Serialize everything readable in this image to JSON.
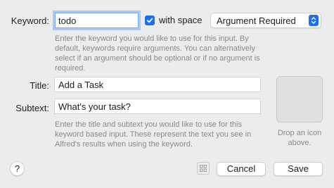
{
  "keyword": {
    "label": "Keyword:",
    "value": "todo",
    "with_space_label": "with space",
    "with_space_checked": true,
    "argument_mode": "Argument Required",
    "help": "Enter the keyword you would like to use for this input. By default, keywords require arguments. You can alternatively select if an argument should be optional or if no argument is required."
  },
  "title": {
    "label": "Title:",
    "value": "Add a Task"
  },
  "subtext": {
    "label": "Subtext:",
    "value": "What's your task?",
    "help": "Enter the title and subtext you would like to use for this keyword based input. These represent the text you see in Alfred's results when using the keyword."
  },
  "icon_well": {
    "hint": "Drop an icon above."
  },
  "footer": {
    "help_label": "?",
    "cancel_label": "Cancel",
    "save_label": "Save"
  },
  "colors": {
    "accent": "#1c6ef2",
    "focus_ring": "#a9c8f4",
    "window_bg": "#ececec"
  }
}
